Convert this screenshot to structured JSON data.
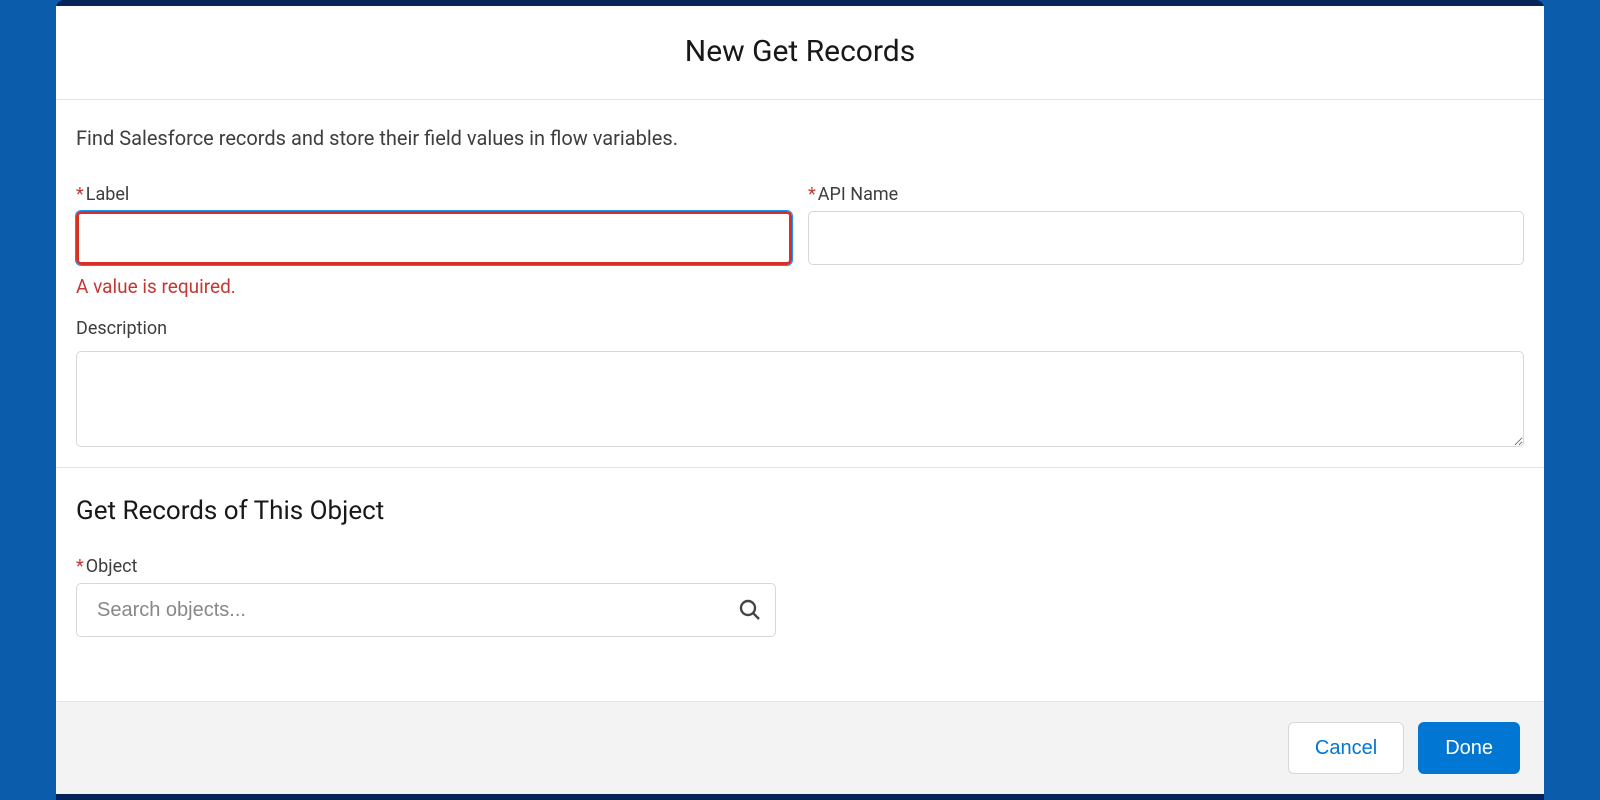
{
  "header": {
    "title": "New Get Records"
  },
  "intro": "Find Salesforce records and store their field values in flow variables.",
  "fields": {
    "label": {
      "label": "Label",
      "required_marker": "*",
      "value": "",
      "error": "A value is required."
    },
    "apiName": {
      "label": "API Name",
      "required_marker": "*",
      "value": ""
    },
    "description": {
      "label": "Description",
      "value": ""
    },
    "object": {
      "section_heading": "Get Records of This Object",
      "label": "Object",
      "required_marker": "*",
      "placeholder": "Search objects...",
      "value": "",
      "icon": "search-icon"
    }
  },
  "footer": {
    "cancel": "Cancel",
    "done": "Done"
  }
}
